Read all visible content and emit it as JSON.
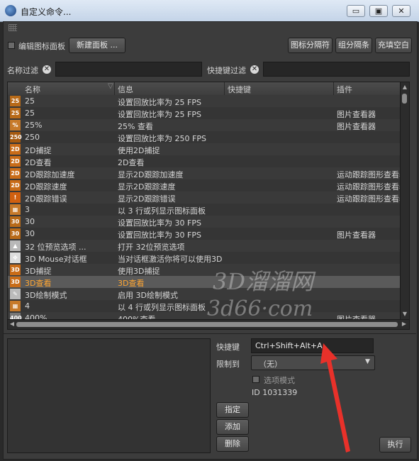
{
  "window": {
    "title": "自定义命令...",
    "minimize": "▭",
    "maximize": "▣",
    "close": "✕"
  },
  "toolbar": {
    "edit_panel_label": "编辑图标面板",
    "new_panel_button": "新建面板 ...",
    "icon_separator_button": "图标分隔符",
    "group_separator_button": "组分隔条",
    "fill_blank_button": "充填空白"
  },
  "filters": {
    "name_filter_label": "名称过滤",
    "name_filter_value": "",
    "shortcut_filter_label": "快捷键过滤",
    "shortcut_filter_value": ""
  },
  "table": {
    "columns": [
      "名称",
      "信息",
      "快捷键",
      "插件"
    ],
    "rows": [
      {
        "icon": "25",
        "name": "25",
        "info": "设置回放比率为 25 FPS",
        "shortcut": "",
        "plugin": ""
      },
      {
        "icon": "25",
        "name": "25",
        "info": "设置回放比率为 25 FPS",
        "shortcut": "",
        "plugin": "图片查看器"
      },
      {
        "icon": "%",
        "name": "25%",
        "info": "25% 查看",
        "shortcut": "",
        "plugin": "图片查看器"
      },
      {
        "icon": "250",
        "name": "250",
        "info": "设置回放比率为 250 FPS",
        "shortcut": "",
        "plugin": ""
      },
      {
        "icon": "2D",
        "name": "2D捕捉",
        "info": "使用2D捕捉",
        "shortcut": "",
        "plugin": ""
      },
      {
        "icon": "2D",
        "name": "2D查看",
        "info": "2D查看",
        "shortcut": "",
        "plugin": ""
      },
      {
        "icon": "2D",
        "name": "2D跟踪加速度",
        "info": "显示2D跟踪加速度",
        "shortcut": "",
        "plugin": "运动跟踪图形查看器"
      },
      {
        "icon": "2D",
        "name": "2D跟踪速度",
        "info": "显示2D跟踪速度",
        "shortcut": "",
        "plugin": "运动跟踪图形查看器"
      },
      {
        "icon": "!",
        "name": "2D跟踪错误",
        "info": "显示2D跟踪错误",
        "shortcut": "",
        "plugin": "运动跟踪图形查看器"
      },
      {
        "icon": "▦",
        "name": "3",
        "info": "以 3 行或列显示图标面板",
        "shortcut": "",
        "plugin": ""
      },
      {
        "icon": "30",
        "name": "30",
        "info": "设置回放比率为 30 FPS",
        "shortcut": "",
        "plugin": ""
      },
      {
        "icon": "30",
        "name": "30",
        "info": "设置回放比率为 30 FPS",
        "shortcut": "",
        "plugin": "图片查看器"
      },
      {
        "icon": "▲",
        "name": "32 位预览选项 ...",
        "info": "打开 32位预览选项",
        "shortcut": "",
        "plugin": ""
      },
      {
        "icon": "✥",
        "name": "3D Mouse对话框",
        "info": "当对话框激活你将可以使用3D",
        "shortcut": "",
        "plugin": ""
      },
      {
        "icon": "3D",
        "name": "3D捕捉",
        "info": "使用3D捕捉",
        "shortcut": "",
        "plugin": ""
      },
      {
        "icon": "3D",
        "name": "3D查看",
        "info": "3D查看",
        "shortcut": "",
        "plugin": "",
        "selected": true
      },
      {
        "icon": "✎",
        "name": "3D绘制模式",
        "info": "启用 3D绘制模式",
        "shortcut": "",
        "plugin": ""
      },
      {
        "icon": "▦",
        "name": "4",
        "info": "以 4 行或列显示图标面板",
        "shortcut": "",
        "plugin": ""
      },
      {
        "icon": "400",
        "name": "400%",
        "info": "400%查看",
        "shortcut": "",
        "plugin": "图片查看器"
      }
    ]
  },
  "details": {
    "shortcut_label": "快捷键",
    "shortcut_value": "Ctrl+Shift+Alt+A",
    "restrict_label": "限制到",
    "restrict_value": "（无）",
    "option_mode_label": "选项模式",
    "id_text": "ID 1031339",
    "assign_button": "指定",
    "add_button": "添加",
    "delete_button": "删除",
    "execute_button": "执行"
  },
  "watermark": {
    "line1": "3D溜溜网",
    "line2": "3d66·com"
  },
  "colors": {
    "selected_text": "#ffa632",
    "annotation_arrow": "#e8312a"
  }
}
